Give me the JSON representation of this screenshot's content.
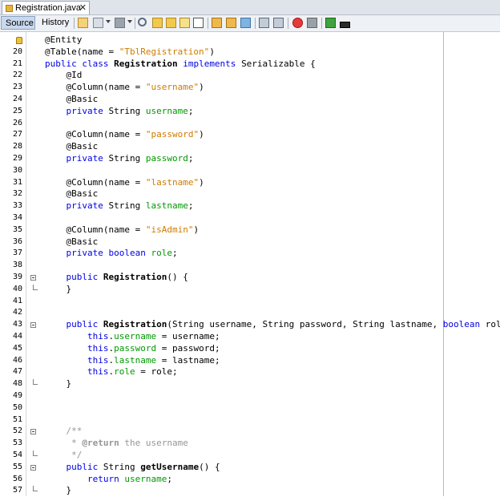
{
  "tab": {
    "title": "Registration.java",
    "close": "✕"
  },
  "toolbar": {
    "source_label": "Source",
    "history_label": "History"
  },
  "lines": [
    {
      "n": "",
      "t": [
        [
          "ann",
          "@Entity"
        ]
      ]
    },
    {
      "n": "20",
      "t": [
        [
          "ann",
          "@Table(name = "
        ],
        [
          "str",
          "\"TblRegistration\""
        ],
        [
          "ann",
          ")"
        ]
      ]
    },
    {
      "n": "21",
      "t": [
        [
          "kw",
          "public class "
        ],
        [
          "bold",
          "Registration"
        ],
        [
          "kw",
          " implements "
        ],
        [
          "",
          "Serializable {"
        ]
      ]
    },
    {
      "n": "22",
      "t": [
        [
          "",
          "    @Id"
        ]
      ]
    },
    {
      "n": "23",
      "t": [
        [
          "",
          "    @Column(name = "
        ],
        [
          "str",
          "\"username\""
        ],
        [
          "",
          ")"
        ]
      ]
    },
    {
      "n": "24",
      "t": [
        [
          "",
          "    @Basic"
        ]
      ]
    },
    {
      "n": "25",
      "t": [
        [
          "kw",
          "    private "
        ],
        [
          "",
          "String "
        ],
        [
          "fld",
          "username"
        ],
        [
          "",
          ";"
        ]
      ]
    },
    {
      "n": "26",
      "t": []
    },
    {
      "n": "27",
      "t": [
        [
          "",
          "    @Column(name = "
        ],
        [
          "str",
          "\"password\""
        ],
        [
          "",
          ")"
        ]
      ]
    },
    {
      "n": "28",
      "t": [
        [
          "",
          "    @Basic"
        ]
      ]
    },
    {
      "n": "29",
      "t": [
        [
          "kw",
          "    private "
        ],
        [
          "",
          "String "
        ],
        [
          "fld",
          "password"
        ],
        [
          "",
          ";"
        ]
      ]
    },
    {
      "n": "30",
      "t": []
    },
    {
      "n": "31",
      "t": [
        [
          "",
          "    @Column(name = "
        ],
        [
          "str",
          "\"lastname\""
        ],
        [
          "",
          ")"
        ]
      ]
    },
    {
      "n": "32",
      "t": [
        [
          "",
          "    @Basic"
        ]
      ]
    },
    {
      "n": "33",
      "t": [
        [
          "kw",
          "    private "
        ],
        [
          "",
          "String "
        ],
        [
          "fld",
          "lastname"
        ],
        [
          "",
          ";"
        ]
      ]
    },
    {
      "n": "34",
      "t": []
    },
    {
      "n": "35",
      "t": [
        [
          "",
          "    @Column(name = "
        ],
        [
          "str",
          "\"isAdmin\""
        ],
        [
          "",
          ")"
        ]
      ]
    },
    {
      "n": "36",
      "t": [
        [
          "",
          "    @Basic"
        ]
      ]
    },
    {
      "n": "37",
      "t": [
        [
          "kw",
          "    private boolean "
        ],
        [
          "fld",
          "role"
        ],
        [
          "",
          ";"
        ]
      ]
    },
    {
      "n": "38",
      "t": []
    },
    {
      "n": "39",
      "t": [
        [
          "kw",
          "    public "
        ],
        [
          "bold",
          "Registration"
        ],
        [
          "",
          "() {"
        ]
      ]
    },
    {
      "n": "40",
      "t": [
        [
          "",
          "    }"
        ]
      ]
    },
    {
      "n": "41",
      "t": []
    },
    {
      "n": "42",
      "t": []
    },
    {
      "n": "43",
      "t": [
        [
          "kw",
          "    public "
        ],
        [
          "bold",
          "Registration"
        ],
        [
          "",
          "(String username, String password, String lastname, "
        ],
        [
          "kw",
          "boolean"
        ],
        [
          "",
          " role) {"
        ]
      ]
    },
    {
      "n": "44",
      "t": [
        [
          "kw",
          "        this"
        ],
        [
          "",
          "."
        ],
        [
          "fld",
          "username"
        ],
        [
          "",
          " = username;"
        ]
      ]
    },
    {
      "n": "45",
      "t": [
        [
          "kw",
          "        this"
        ],
        [
          "",
          "."
        ],
        [
          "fld",
          "password"
        ],
        [
          "",
          " = password;"
        ]
      ]
    },
    {
      "n": "46",
      "t": [
        [
          "kw",
          "        this"
        ],
        [
          "",
          "."
        ],
        [
          "fld",
          "lastname"
        ],
        [
          "",
          " = lastname;"
        ]
      ]
    },
    {
      "n": "47",
      "t": [
        [
          "kw",
          "        this"
        ],
        [
          "",
          "."
        ],
        [
          "fld",
          "role"
        ],
        [
          "",
          " = role;"
        ]
      ]
    },
    {
      "n": "48",
      "t": [
        [
          "",
          "    }"
        ]
      ]
    },
    {
      "n": "49",
      "t": []
    },
    {
      "n": "50",
      "t": []
    },
    {
      "n": "51",
      "t": []
    },
    {
      "n": "52",
      "t": [
        [
          "cmt",
          "    /**"
        ]
      ]
    },
    {
      "n": "53",
      "t": [
        [
          "cmt",
          "     * "
        ],
        [
          "doctag",
          "@return"
        ],
        [
          "cmt",
          " the username"
        ]
      ]
    },
    {
      "n": "54",
      "t": [
        [
          "cmt",
          "     */"
        ]
      ]
    },
    {
      "n": "55",
      "t": [
        [
          "kw",
          "    public "
        ],
        [
          "",
          "String "
        ],
        [
          "bold",
          "getUsername"
        ],
        [
          "",
          "() {"
        ]
      ]
    },
    {
      "n": "56",
      "t": [
        [
          "kw",
          "        return "
        ],
        [
          "fld",
          "username"
        ],
        [
          "",
          ";"
        ]
      ]
    },
    {
      "n": "57",
      "t": [
        [
          "",
          "    }"
        ]
      ]
    }
  ],
  "folds": [
    {
      "line": 20,
      "kind": "open"
    },
    {
      "line": 21,
      "kind": "end"
    },
    {
      "line": 24,
      "kind": "open"
    },
    {
      "line": 29,
      "kind": "end"
    },
    {
      "line": 33,
      "kind": "open"
    },
    {
      "line": 35,
      "kind": "end"
    },
    {
      "line": 36,
      "kind": "open"
    },
    {
      "line": 38,
      "kind": "end"
    }
  ],
  "colors": {
    "keyword": "#0000e6",
    "string": "#ce7b00",
    "field": "#009900",
    "comment": "#969696",
    "margin": "#f4a0a0"
  },
  "icons": [
    "toggle-bookmark-icon",
    "history-back-icon",
    "history-forward-icon",
    "search-icon",
    "find-previous-icon",
    "find-next-icon",
    "toggle-highlight-icon",
    "toggle-rect-select-icon",
    "previous-bookmark-icon",
    "next-bookmark-icon",
    "toggle-bookmark-icon",
    "shift-left-icon",
    "shift-right-icon",
    "start-macro-icon",
    "stop-macro-icon",
    "run-icon",
    "debug-icon"
  ]
}
